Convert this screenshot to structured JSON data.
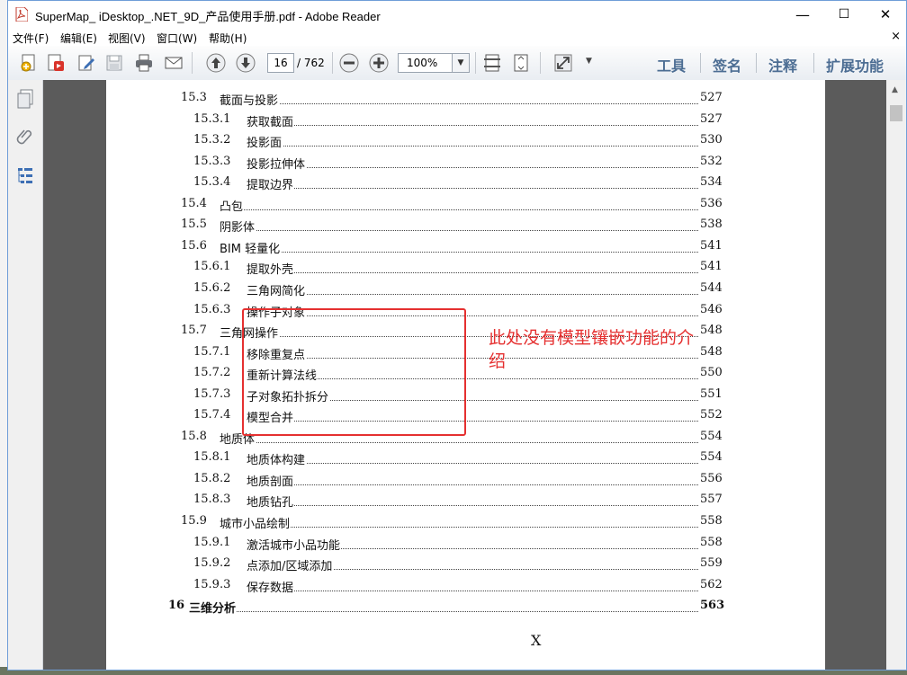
{
  "window": {
    "title": "SuperMap_ iDesktop_.NET_9D_产品使用手册.pdf - Adobe Reader",
    "controls": {
      "minimize": "—",
      "maximize": "☐",
      "close": "✕"
    }
  },
  "menu": {
    "items": [
      "文件(F)",
      "编辑(E)",
      "视图(V)",
      "窗口(W)",
      "帮助(H)"
    ],
    "close": "×"
  },
  "toolbar": {
    "page_current": "16",
    "page_total": "/ 762",
    "zoom": "100%",
    "right_buttons": [
      "工具",
      "签名",
      "注释",
      "扩展功能"
    ]
  },
  "toc": [
    {
      "num": "15.3",
      "title": "截面与投影",
      "page": "527",
      "level": 1
    },
    {
      "num": "15.3.1",
      "title": "获取截面",
      "page": "527",
      "level": 2
    },
    {
      "num": "15.3.2",
      "title": "投影面",
      "page": "530",
      "level": 2
    },
    {
      "num": "15.3.3",
      "title": "投影拉伸体",
      "page": "532",
      "level": 2
    },
    {
      "num": "15.3.4",
      "title": "提取边界",
      "page": "534",
      "level": 2
    },
    {
      "num": "15.4",
      "title": "凸包",
      "page": "536",
      "level": 1
    },
    {
      "num": "15.5",
      "title": "阴影体",
      "page": "538",
      "level": 1
    },
    {
      "num": "15.6",
      "title": "BIM 轻量化",
      "page": "541",
      "level": 1
    },
    {
      "num": "15.6.1",
      "title": "提取外壳",
      "page": "541",
      "level": 2
    },
    {
      "num": "15.6.2",
      "title": "三角网简化",
      "page": "544",
      "level": 2
    },
    {
      "num": "15.6.3",
      "title": "操作子对象",
      "page": "546",
      "level": 2
    },
    {
      "num": "15.7",
      "title": "三角网操作",
      "page": "548",
      "level": 1
    },
    {
      "num": "15.7.1",
      "title": "移除重复点",
      "page": "548",
      "level": 2
    },
    {
      "num": "15.7.2",
      "title": "重新计算法线",
      "page": "550",
      "level": 2
    },
    {
      "num": "15.7.3",
      "title": "子对象拓扑拆分",
      "page": "551",
      "level": 2
    },
    {
      "num": "15.7.4",
      "title": "模型合并",
      "page": "552",
      "level": 2
    },
    {
      "num": "15.8",
      "title": "地质体",
      "page": "554",
      "level": 1
    },
    {
      "num": "15.8.1",
      "title": "地质体构建",
      "page": "554",
      "level": 2
    },
    {
      "num": "15.8.2",
      "title": "地质剖面",
      "page": "556",
      "level": 2
    },
    {
      "num": "15.8.3",
      "title": "地质钻孔",
      "page": "557",
      "level": 2
    },
    {
      "num": "15.9",
      "title": "城市小品绘制",
      "page": "558",
      "level": 1
    },
    {
      "num": "15.9.1",
      "title": "激活城市小品功能",
      "page": "558",
      "level": 2
    },
    {
      "num": "15.9.2",
      "title": "点添加/区域添加",
      "page": "559",
      "level": 2
    },
    {
      "num": "15.9.3",
      "title": "保存数据",
      "page": "562",
      "level": 2
    },
    {
      "num": "16",
      "title": "三维分析",
      "page": "563",
      "level": 0
    }
  ],
  "annotation": "此处没有模型镶嵌功能的介绍",
  "page_footer": "X",
  "colors": {
    "annotation": "#e53030",
    "toolbar_text": "#4c6d93"
  }
}
